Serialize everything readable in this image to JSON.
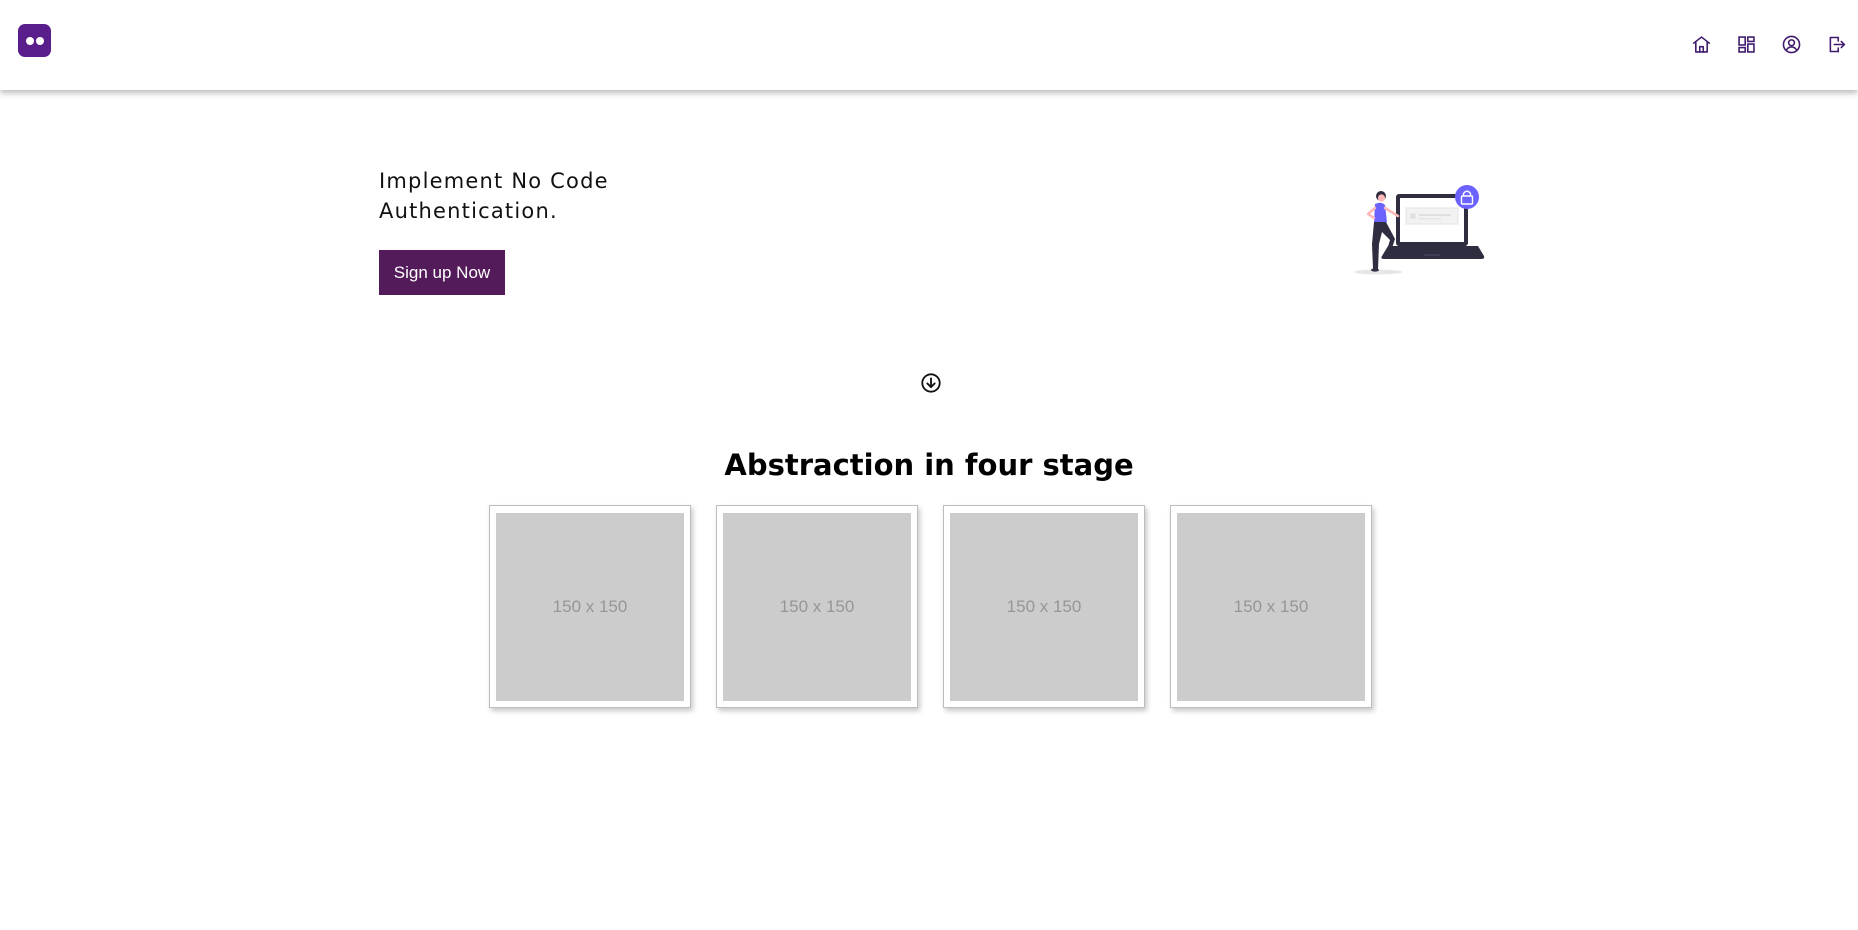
{
  "header": {
    "logo_icon": "robot-face-logo",
    "nav": [
      {
        "icon": "home-icon"
      },
      {
        "icon": "dashboard-icon"
      },
      {
        "icon": "user-account-icon"
      },
      {
        "icon": "logout-icon"
      }
    ]
  },
  "hero": {
    "heading_line1": "Implement No Code",
    "heading_line2": "Authentication.",
    "cta_label": "Sign up Now",
    "illustration": "person-with-laptop-lock-illustration"
  },
  "scroll_icon": "arrow-down-circle-icon",
  "section": {
    "title": "Abstraction in four stage",
    "stages": [
      {
        "placeholder": "150 x 150"
      },
      {
        "placeholder": "150 x 150"
      },
      {
        "placeholder": "150 x 150"
      },
      {
        "placeholder": "150 x 150"
      }
    ]
  },
  "colors": {
    "brand_purple": "#5a1e8c",
    "cta_background": "#541b5a",
    "nav_icon": "#3f1a6e",
    "illustration_accent": "#6c63ff",
    "placeholder_bg": "#cccccc"
  }
}
